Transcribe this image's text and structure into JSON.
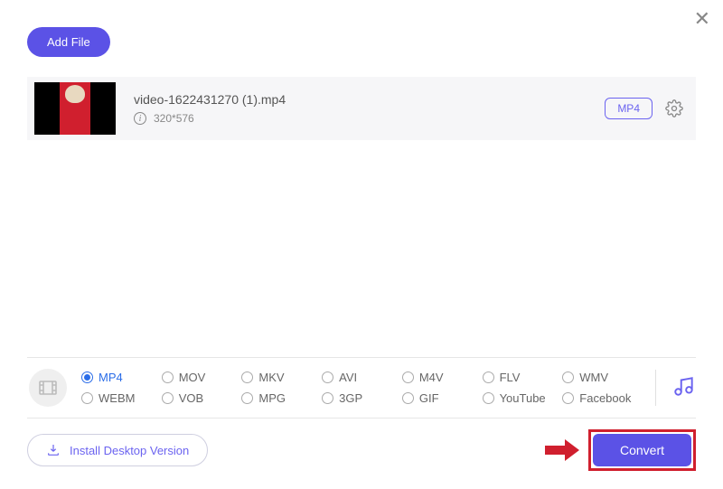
{
  "buttons": {
    "add_file": "Add File",
    "install_desktop": "Install Desktop Version",
    "convert": "Convert"
  },
  "file": {
    "name": "video-1622431270 (1).mp4",
    "resolution": "320*576",
    "target_format": "MP4"
  },
  "formats": {
    "row1": [
      "MP4",
      "MOV",
      "MKV",
      "AVI",
      "M4V",
      "FLV",
      "WMV"
    ],
    "row2": [
      "WEBM",
      "VOB",
      "MPG",
      "3GP",
      "GIF",
      "YouTube",
      "Facebook"
    ],
    "selected": "MP4"
  }
}
